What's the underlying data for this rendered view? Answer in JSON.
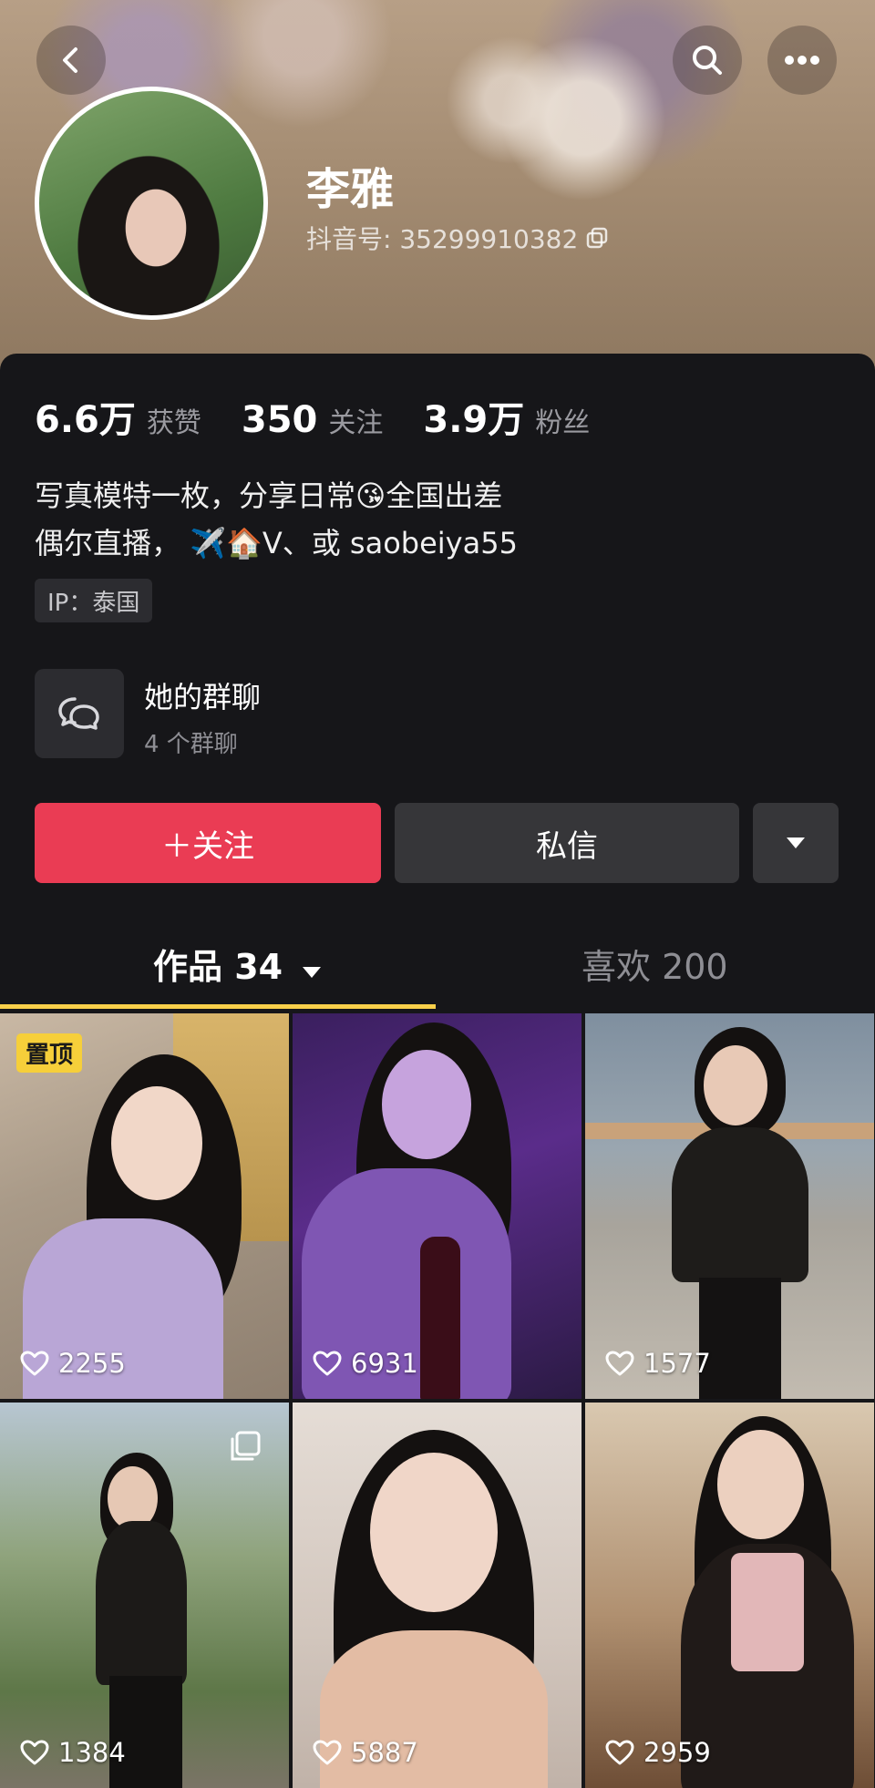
{
  "header": {
    "back_icon": "back-arrow-icon",
    "search_icon": "search-icon",
    "more_icon": "more-dots-icon"
  },
  "profile": {
    "name": "李雅",
    "douyin_id": "抖音号: 35299910382",
    "copy_icon": "copy-icon"
  },
  "stats": [
    {
      "value": "6.6万",
      "label": "获赞"
    },
    {
      "value": "350",
      "label": "关注"
    },
    {
      "value": "3.9万",
      "label": "粉丝"
    }
  ],
  "bio": {
    "line1": "写真模特一枚，分享日常😘全国出差",
    "line2": "偶尔直播， ✈️🏠V、或 saobeiya55"
  },
  "ip_tag": "IP：泰国",
  "group_chat": {
    "title": "她的群聊",
    "subtitle": "4 个群聊"
  },
  "actions": {
    "follow_label": "＋关注",
    "message_label": "私信"
  },
  "tabs": {
    "works": "作品 34",
    "likes": "喜欢 200"
  },
  "videos": [
    {
      "likes": "2255",
      "pinned_label": "置顶"
    },
    {
      "likes": "6931"
    },
    {
      "likes": "1577"
    },
    {
      "likes": "1384"
    },
    {
      "likes": "5887"
    },
    {
      "likes": "2959"
    }
  ],
  "colors": {
    "accent": "#ea3c54",
    "tab_indicator": "#f8d04a",
    "background": "#161619"
  }
}
